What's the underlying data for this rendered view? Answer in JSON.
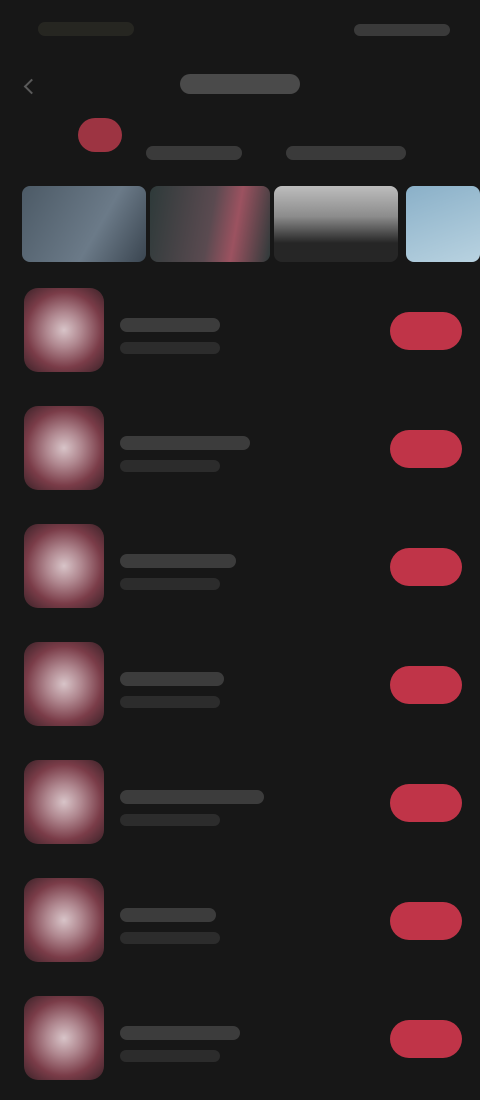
{
  "status_bar": {},
  "header": {},
  "tabs": [
    {},
    {}
  ],
  "banners": [
    {},
    {},
    {},
    {}
  ],
  "list": [
    {},
    {},
    {},
    {},
    {},
    {},
    {}
  ],
  "colors": {
    "background": "#171717",
    "accent": "#c03448",
    "text_placeholder": "#3c3c3c"
  },
  "icons": {
    "back": "chevron-left-icon"
  }
}
